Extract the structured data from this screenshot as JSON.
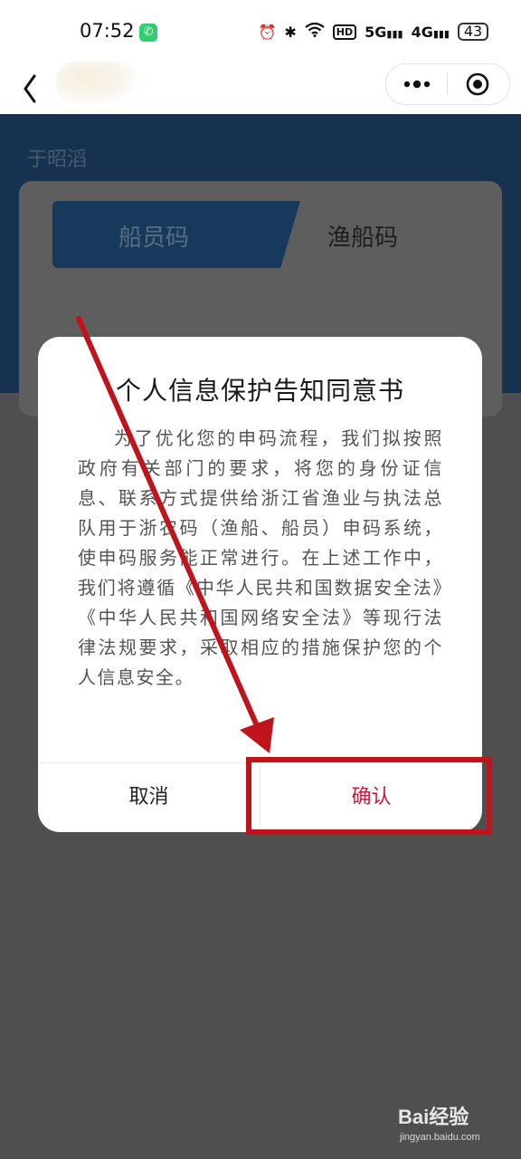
{
  "status_bar": {
    "time": "07:52",
    "battery": "43",
    "icons": [
      "alarm-icon",
      "bluetooth-icon",
      "wifi-icon",
      "hd-icon",
      "5g-signal-icon",
      "4g-signal-icon",
      "battery-icon"
    ],
    "hd_label": "HD",
    "net1_label": "5G",
    "net2_label": "4G"
  },
  "nav": {
    "back_icon": "chevron-left-icon",
    "more_icon": "more-dots-icon",
    "close_icon": "target-circle-icon"
  },
  "header": {
    "user_name": "于昭滔"
  },
  "tabs": [
    {
      "label": "船员码",
      "active": true
    },
    {
      "label": "渔船码",
      "active": false
    }
  ],
  "dialog": {
    "title": "个人信息保护告知同意书",
    "body": "为了优化您的申码流程，我们拟按照政府有关部门的要求，将您的身份证信息、联系方式提供给浙江省渔业与执法总队用于浙农码（渔船、船员）申码系统，使申码服务能正常进行。在上述工作中，我们将遵循《中华人民共和国数据安全法》《中华人民共和国网络安全法》等现行法律法规要求，采取相应的措施保护您的个人信息安全。",
    "cancel_label": "取消",
    "confirm_label": "确认"
  },
  "annotation": {
    "arrow_color": "#c0141c",
    "box_color": "#c0141c"
  },
  "watermark": {
    "main": "Bai经验",
    "sub": "jingyan.baidu.com"
  },
  "colors": {
    "brand_blue": "#163250",
    "confirm_red": "#c41e3a",
    "overlay_gray": "#4f4f4f"
  }
}
